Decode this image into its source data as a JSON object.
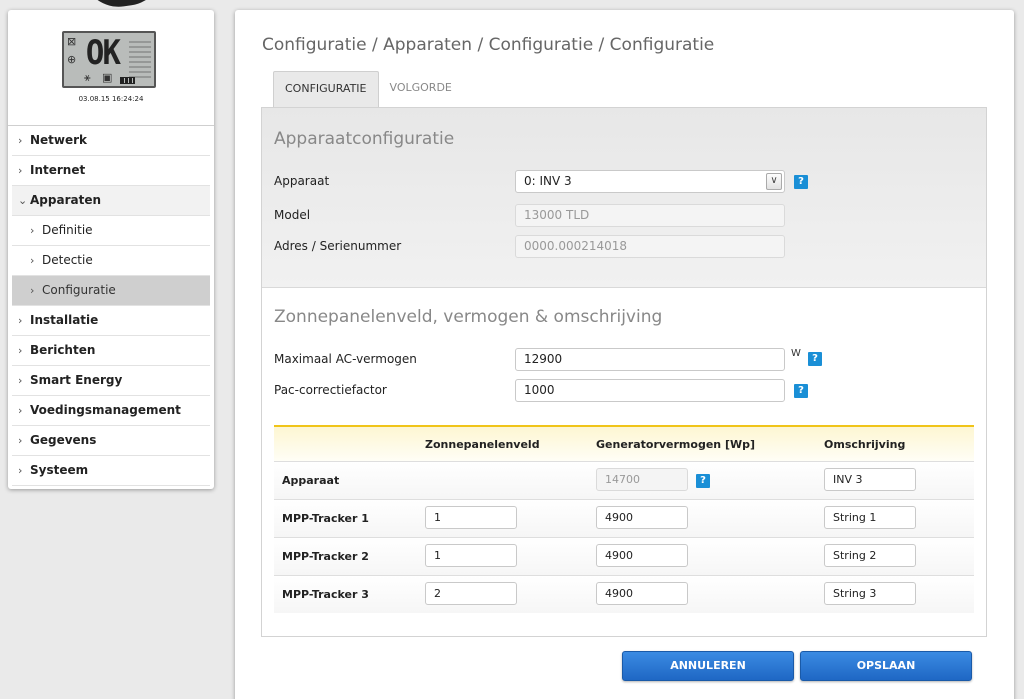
{
  "device": {
    "lcd_text": "OK",
    "datetime": "03.08.15 16:24:24"
  },
  "sidebar": {
    "items": [
      {
        "label": "Netwerk",
        "chev": "›"
      },
      {
        "label": "Internet",
        "chev": "›"
      },
      {
        "label": "Apparaten",
        "chev": "⌄"
      },
      {
        "label": "Definitie",
        "chev": "›"
      },
      {
        "label": "Detectie",
        "chev": "›"
      },
      {
        "label": "Configuratie",
        "chev": "›"
      },
      {
        "label": "Installatie",
        "chev": "›"
      },
      {
        "label": "Berichten",
        "chev": "›"
      },
      {
        "label": "Smart Energy",
        "chev": "›"
      },
      {
        "label": "Voedingsmanagement",
        "chev": "›"
      },
      {
        "label": "Gegevens",
        "chev": "›"
      },
      {
        "label": "Systeem",
        "chev": "›"
      }
    ]
  },
  "breadcrumb": "Configuratie / Apparaten / Configuratie / Configuratie",
  "tabs": [
    {
      "label": "CONFIGURATIE"
    },
    {
      "label": "VOLGORDE"
    }
  ],
  "device_config": {
    "title": "Apparaatconfiguratie",
    "device_label": "Apparaat",
    "device_value": "0: INV 3",
    "model_label": "Model",
    "model_value": "13000 TLD",
    "address_label": "Adres / Serienummer",
    "address_value": "0000.000214018"
  },
  "solar": {
    "title": "Zonnepanelenveld, vermogen & omschrijving",
    "max_ac_label": "Maximaal AC-vermogen",
    "max_ac_value": "12900",
    "max_ac_unit": "W",
    "pac_label": "Pac-correctiefactor",
    "pac_value": "1000"
  },
  "table": {
    "headers": {
      "field": "Zonnepanelenveld",
      "generator": "Generatorvermogen [Wp]",
      "description": "Omschrijving"
    },
    "rows": [
      {
        "label": "Apparaat",
        "field": "",
        "generator": "14700",
        "description": "INV 3"
      },
      {
        "label": "MPP-Tracker 1",
        "field": "1",
        "generator": "4900",
        "description": "String 1"
      },
      {
        "label": "MPP-Tracker 2",
        "field": "1",
        "generator": "4900",
        "description": "String 2"
      },
      {
        "label": "MPP-Tracker 3",
        "field": "2",
        "generator": "4900",
        "description": "String 3"
      }
    ]
  },
  "help_glyph": "?",
  "select_arrow": "∨",
  "buttons": {
    "cancel": "ANNULEREN",
    "save": "OPSLAAN"
  },
  "colors": {
    "accent_blue": "#1f67c4",
    "help_blue": "#1a8fd6",
    "table_header_line": "#f0c419"
  }
}
